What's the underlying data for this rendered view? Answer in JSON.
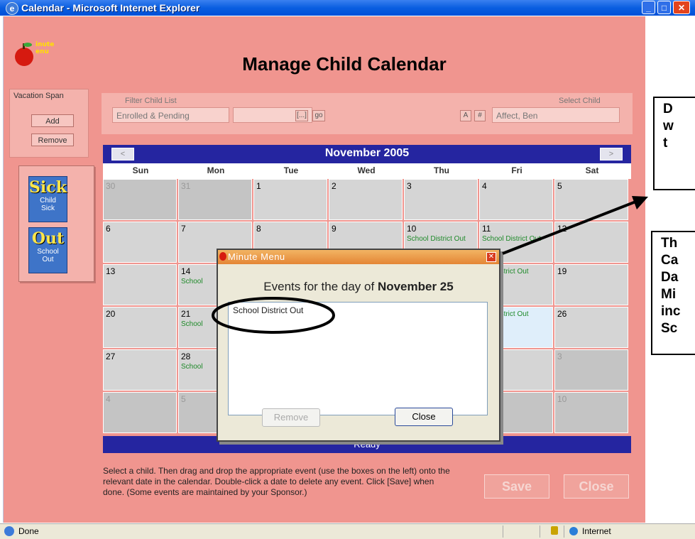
{
  "window": {
    "title": "Calendar - Microsoft Internet Explorer"
  },
  "logo": {
    "text_top": "inute",
    "text_bottom": "enu"
  },
  "page_title": "Manage Child Calendar",
  "vacation": {
    "label": "Vacation Span",
    "add": "Add",
    "remove": "Remove"
  },
  "events": [
    {
      "big": "Sick",
      "label1": "Child",
      "label2": "Sick"
    },
    {
      "big": "Out",
      "label1": "School",
      "label2": "Out"
    }
  ],
  "filter": {
    "label": "Filter Child List",
    "value": "Enrolled & Pending",
    "browse": "[...]",
    "go": "go",
    "select_label": "Select Child",
    "alpha_btn": "A",
    "num_btn": "#",
    "child": "Affect, Ben"
  },
  "calendar": {
    "month": "November 2005",
    "prev": "<",
    "next": ">",
    "days": [
      "Sun",
      "Mon",
      "Tue",
      "Wed",
      "Thu",
      "Fri",
      "Sat"
    ],
    "status": "Ready",
    "weeks": [
      [
        {
          "d": "30",
          "dim": true
        },
        {
          "d": "31",
          "dim": true
        },
        {
          "d": "1"
        },
        {
          "d": "2"
        },
        {
          "d": "3"
        },
        {
          "d": "4"
        },
        {
          "d": "5"
        }
      ],
      [
        {
          "d": "6"
        },
        {
          "d": "7"
        },
        {
          "d": "8"
        },
        {
          "d": "9"
        },
        {
          "d": "10",
          "e": "School District Out"
        },
        {
          "d": "11",
          "e": "School District Out"
        },
        {
          "d": "12"
        }
      ],
      [
        {
          "d": "13"
        },
        {
          "d": "14",
          "e": "School"
        },
        {
          "d": ""
        },
        {
          "d": ""
        },
        {
          "d": ""
        },
        {
          "d": "",
          "e": "ool District Out"
        },
        {
          "d": "19"
        }
      ],
      [
        {
          "d": "20"
        },
        {
          "d": "21",
          "e": "School"
        },
        {
          "d": ""
        },
        {
          "d": ""
        },
        {
          "d": ""
        },
        {
          "d": "",
          "e": "ool District Out",
          "hl": true
        },
        {
          "d": "26"
        }
      ],
      [
        {
          "d": "27"
        },
        {
          "d": "28",
          "e": "School"
        },
        {
          "d": ""
        },
        {
          "d": ""
        },
        {
          "d": ""
        },
        {
          "d": ""
        },
        {
          "d": "3",
          "dim": true
        }
      ],
      [
        {
          "d": "4",
          "dim": true
        },
        {
          "d": "5",
          "dim": true
        },
        {
          "d": "",
          "dim": true
        },
        {
          "d": "",
          "dim": true
        },
        {
          "d": "",
          "dim": true
        },
        {
          "d": "",
          "dim": true
        },
        {
          "d": "10",
          "dim": true
        }
      ]
    ]
  },
  "instructions": "Select a child. Then drag and drop the appropriate event (use the boxes on the left) onto the relevant date in the calendar. Double-click a date to delete any event. Click [Save] when done. (Some events are maintained by your Sponsor.)",
  "buttons": {
    "save": "Save",
    "close": "Close"
  },
  "popup": {
    "title": "Minute Menu",
    "heading_prefix": "Events for the day of",
    "heading_date": "November 25",
    "item": "School District Out",
    "remove": "Remove",
    "close": "Close"
  },
  "annotations": {
    "box1": [
      "D",
      "w",
      "t"
    ],
    "box2": [
      "Th",
      "Ca",
      "Da",
      "Mi",
      "inc",
      "Sc"
    ]
  },
  "status": {
    "left": "Done",
    "zone": "Internet"
  }
}
